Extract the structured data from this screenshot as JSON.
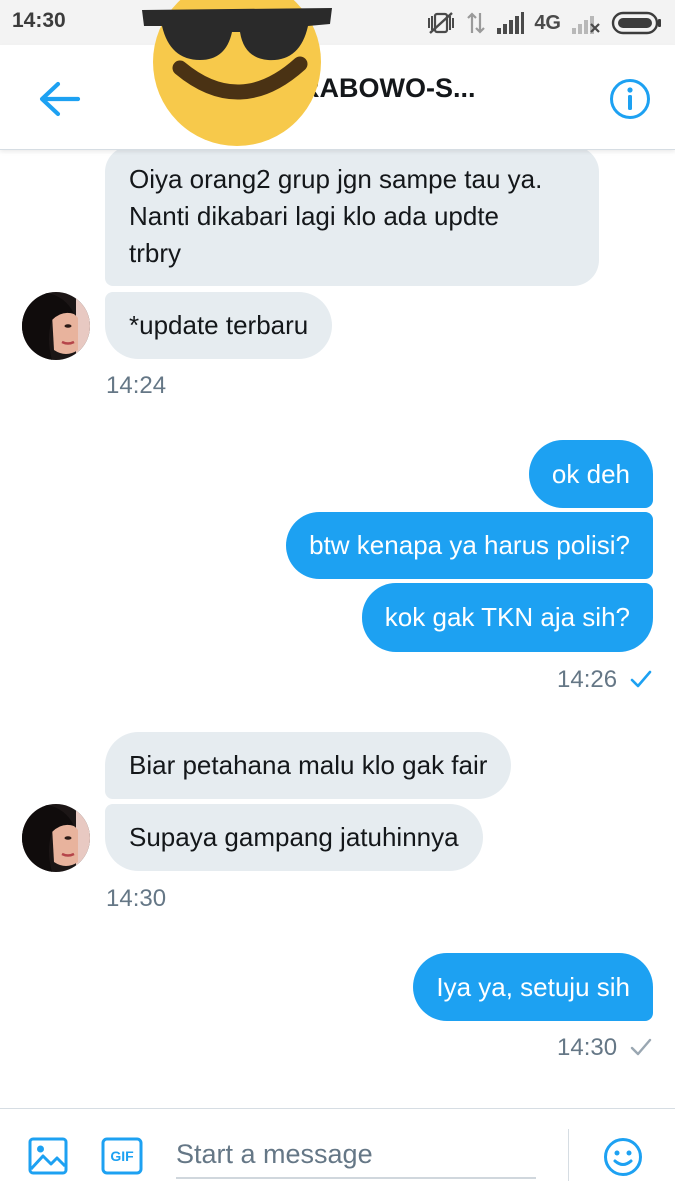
{
  "status_bar": {
    "time": "14:30",
    "network": "4G"
  },
  "header": {
    "title": "RABOWO-S...",
    "back_icon": "arrow-left-icon",
    "info_icon": "info-icon",
    "sticker": "sunglasses-emoji-sticker"
  },
  "colors": {
    "accent": "#1da1f2",
    "incoming_bubble": "#e6ecf0",
    "muted_text": "#657786"
  },
  "conversation": {
    "group1": {
      "messages": [
        {
          "lines": [
            "Oiya orang2 grup jgn sampe tau ya.",
            "Nanti dikabari lagi klo ada updte",
            "trbry"
          ]
        },
        {
          "text": "*update terbaru"
        }
      ],
      "time": "14:24"
    },
    "group2": {
      "messages": [
        {
          "text": "ok deh"
        },
        {
          "text": "btw kenapa ya harus polisi?"
        },
        {
          "text": "kok gak TKN aja sih?"
        }
      ],
      "time": "14:26",
      "status": "read"
    },
    "group3": {
      "messages": [
        {
          "text": "Biar petahana malu klo gak fair"
        },
        {
          "text": "Supaya gampang jatuhinnya"
        }
      ],
      "time": "14:30"
    },
    "group4": {
      "messages": [
        {
          "text": "Iya ya, setuju sih"
        }
      ],
      "time": "14:30",
      "status": "sent"
    }
  },
  "composer": {
    "placeholder": "Start a message",
    "gif_label": "GIF",
    "media_icon": "image-icon",
    "emoji_icon": "smiley-icon"
  }
}
